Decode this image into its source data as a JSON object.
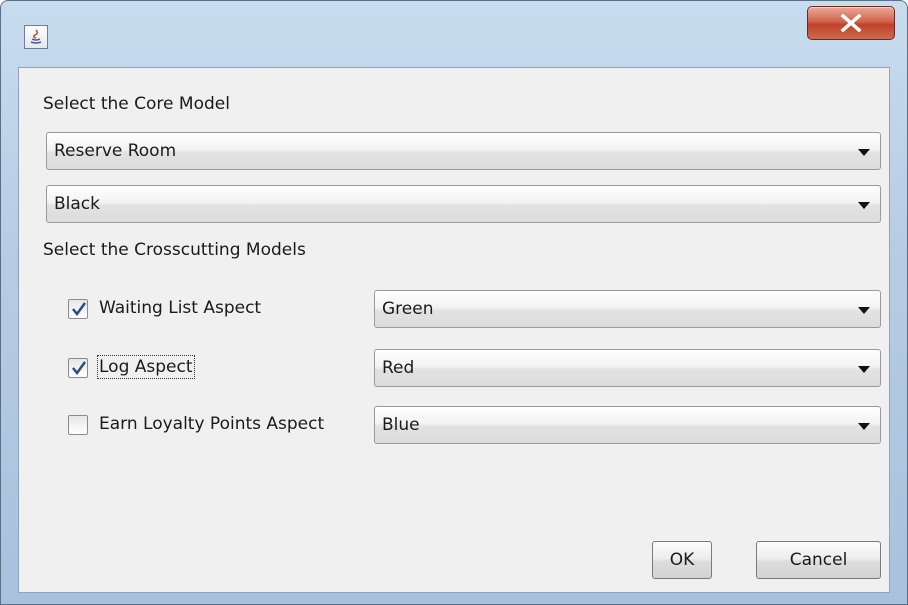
{
  "window": {
    "title": "",
    "close_glyph": "X"
  },
  "core": {
    "label": "Select the Core Model",
    "model_value": "Reserve Room",
    "color_value": "Black"
  },
  "crosscutting": {
    "label": "Select the Crosscutting Models",
    "items": [
      {
        "label": "Waiting List Aspect",
        "checked": true,
        "color_value": "Green"
      },
      {
        "label": "Log Aspect",
        "checked": true,
        "color_value": "Red"
      },
      {
        "label": "Earn Loyalty Points Aspect",
        "checked": false,
        "color_value": "Blue"
      }
    ]
  },
  "buttons": {
    "ok": "OK",
    "cancel": "Cancel"
  },
  "colors": {
    "check_mark": "#2b4a86",
    "close_button": "#c94a34"
  }
}
